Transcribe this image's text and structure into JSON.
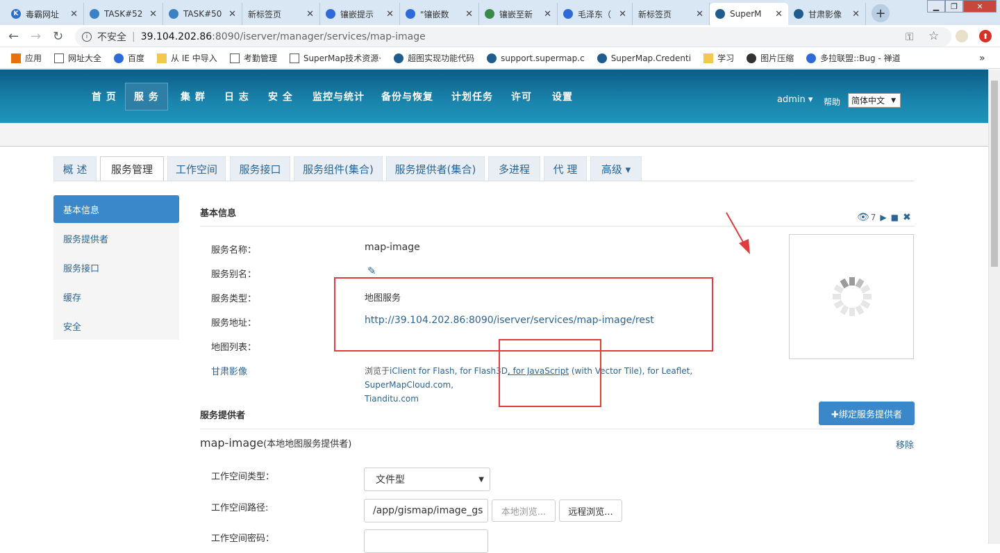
{
  "browser": {
    "tabs": [
      {
        "title": "毒霸网址",
        "icon_color": "#2b6fce",
        "icon_letter": "K"
      },
      {
        "title": "TASK#52",
        "icon_color": "#3b82c4",
        "icon_letter": ""
      },
      {
        "title": "TASK#50",
        "icon_color": "#3b82c4",
        "icon_letter": ""
      },
      {
        "title": "新标签页",
        "icon_color": "",
        "icon_letter": ""
      },
      {
        "title": "镶嵌提示",
        "icon_color": "#2f6bd8",
        "icon_letter": ""
      },
      {
        "title": "\"镶嵌数",
        "icon_color": "#2f6bd8",
        "icon_letter": ""
      },
      {
        "title": "镶嵌至新",
        "icon_color": "#3a8a4a",
        "icon_letter": ""
      },
      {
        "title": "毛泽东（",
        "icon_color": "#2f6bd8",
        "icon_letter": ""
      },
      {
        "title": "新标签页",
        "icon_color": "",
        "icon_letter": ""
      },
      {
        "title": "SuperM",
        "icon_color": "#1f5d8f",
        "icon_letter": ""
      },
      {
        "title": "甘肃影像",
        "icon_color": "#1f5d8f",
        "icon_letter": ""
      }
    ],
    "new_tab_label": "+",
    "url": {
      "security": "不安全",
      "host": "39.104.202.86",
      "path": ":8090/iserver/manager/services/map-image"
    },
    "bookmarks": [
      "应用",
      "网址大全",
      "百度",
      "从 IE 中导入",
      "考勤管理",
      "SuperMap技术资源·",
      "超图实现功能代码",
      "support.supermap.c",
      "SuperMap.Credenti",
      "学习",
      "图片压缩",
      "多拉联盟::Bug - 禅道"
    ],
    "bookmark_more": "»"
  },
  "header": {
    "nav": [
      "首 页",
      "服 务",
      "集 群",
      "日 志",
      "安 全",
      "监控与统计",
      "备份与恢复",
      "计划任务",
      "许可",
      "设置"
    ],
    "user": "admin ▾",
    "help": "帮助",
    "language": "简体中文"
  },
  "subtabs": [
    "概 述",
    "服务管理",
    "工作空间",
    "服务接口",
    "服务组件(集合)",
    "服务提供者(集合)",
    "多进程",
    "代 理",
    "高级 ▾"
  ],
  "leftnav": [
    "基本信息",
    "服务提供者",
    "服务接口",
    "缓存",
    "安全"
  ],
  "basic": {
    "title": "基本信息",
    "view_count": "7",
    "rows": [
      {
        "label": "服务名称：",
        "value": "map-image"
      },
      {
        "label": "服务别名：",
        "value": ""
      },
      {
        "label": "服务类型：",
        "value": "地图服务"
      },
      {
        "label": "服务地址：",
        "value": "http://39.104.202.86:8090/iserver/services/map-image/rest"
      },
      {
        "label": "地图列表：",
        "value": ""
      }
    ],
    "map_name": "甘肃影像",
    "browse_prefix": "浏览于",
    "browse_links": [
      "iClient for Flash",
      ", for Flash3D",
      ", for JavaScript",
      " (with Vector Tile)",
      ", for Leaflet",
      ", SuperMapCloud.com,"
    ],
    "browse_line2": "Tianditu.com"
  },
  "provider": {
    "title": "服务提供者",
    "bind_button": "✚绑定服务提供者",
    "name": "map-image",
    "name_suffix": "(本地地图服务提供者)",
    "remove": "移除",
    "ws_type_label": "工作空间类型：",
    "ws_type_value": "文件型",
    "ws_path_label": "工作空间路径:",
    "ws_path_value": "/app/gismap/image_gs",
    "local_browse": "本地浏览...",
    "remote_browse": "远程浏览...",
    "ws_pwd_label": "工作空间密码："
  }
}
